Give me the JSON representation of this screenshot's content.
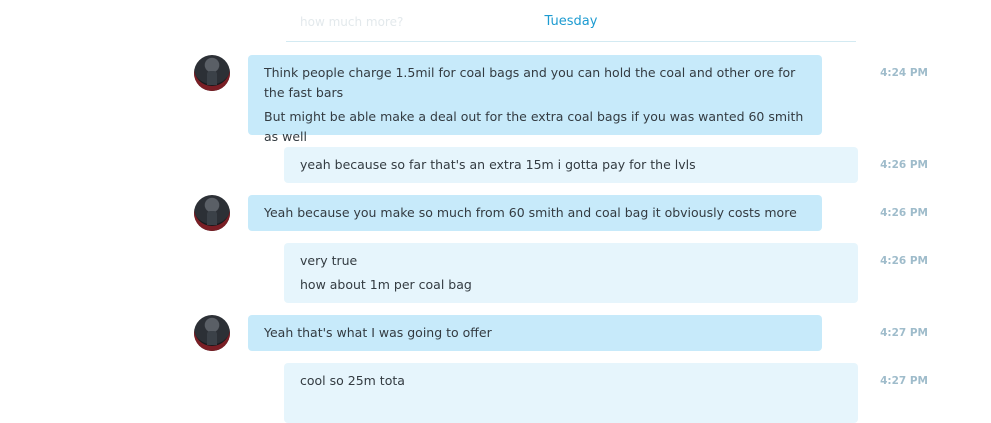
{
  "ghost_message": "how much more?",
  "divider": {
    "label": "Tuesday"
  },
  "messages": [
    {
      "sender": "them",
      "lines": [
        "Think people charge 1.5mil for coal bags and you can hold the coal and other ore for the fast bars",
        "But might be able make a deal out for the extra coal bags if you was wanted 60 smith as well"
      ],
      "time": "4:24 PM"
    },
    {
      "sender": "me",
      "lines": [
        "yeah because so far that's an extra 15m i gotta pay for the lvls"
      ],
      "time": "4:26 PM"
    },
    {
      "sender": "them",
      "lines": [
        "Yeah because you make so much from 60 smith and coal bag it obviously costs more"
      ],
      "time": "4:26 PM"
    },
    {
      "sender": "me",
      "lines": [
        "very true",
        "how about 1m per coal bag"
      ],
      "time": "4:26 PM"
    },
    {
      "sender": "them",
      "lines": [
        "Yeah that's what I was going to offer"
      ],
      "time": "4:27 PM"
    },
    {
      "sender": "me",
      "lines": [
        "cool so 25m tota"
      ],
      "time": "4:27 PM"
    }
  ]
}
